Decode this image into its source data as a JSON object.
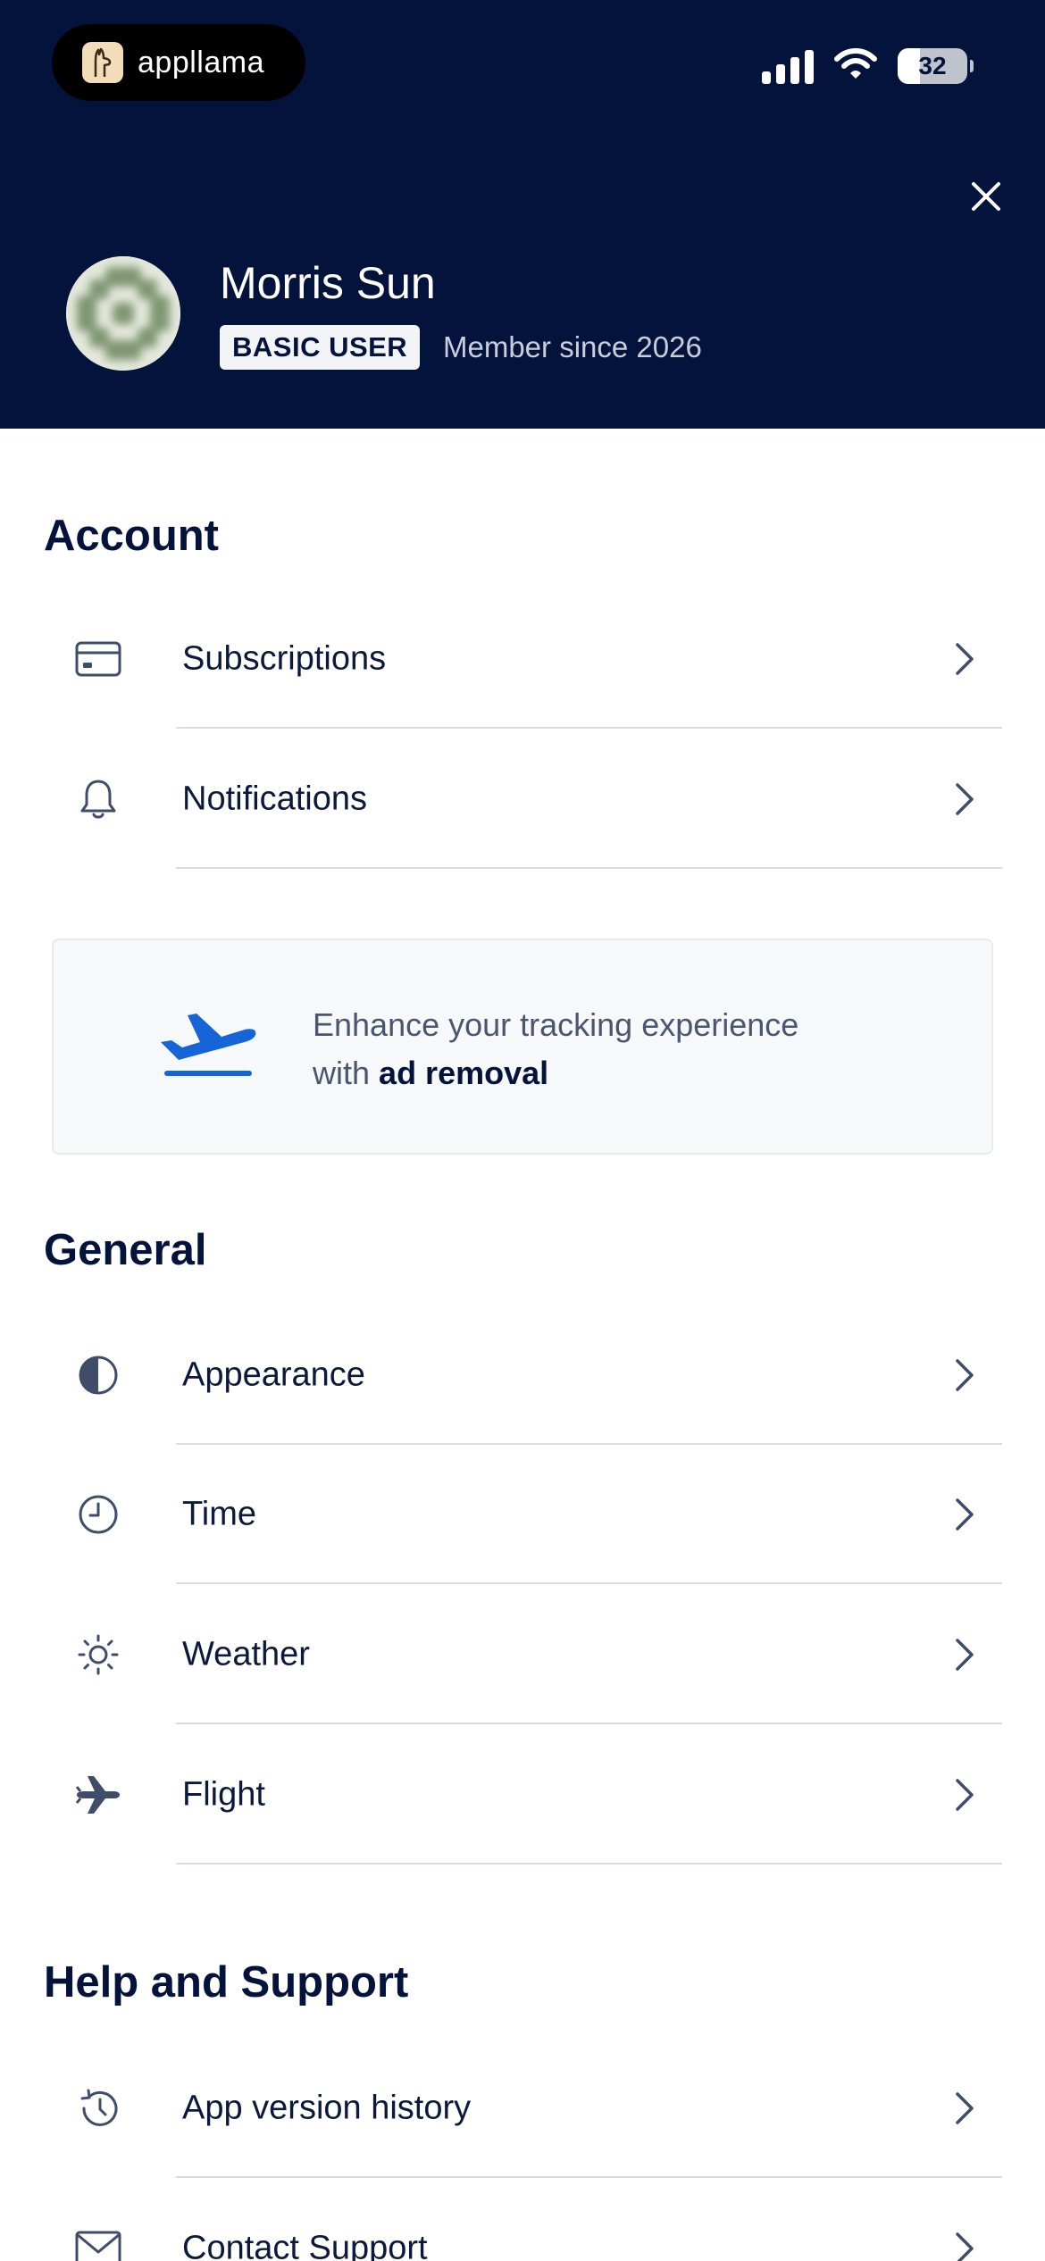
{
  "status_bar": {
    "app_name": "appllama",
    "battery_level": "32"
  },
  "profile": {
    "name": "Morris Sun",
    "badge": "BASIC USER",
    "member_since": "Member since 2026"
  },
  "sections": {
    "account": {
      "title": "Account",
      "items": [
        {
          "label": "Subscriptions",
          "icon": "credit-card-icon"
        },
        {
          "label": "Notifications",
          "icon": "bell-icon"
        }
      ]
    },
    "promo": {
      "text_line1": "Enhance your tracking experience",
      "text_prefix": "with",
      "text_bold": "ad removal"
    },
    "general": {
      "title": "General",
      "items": [
        {
          "label": "Appearance",
          "icon": "half-circle-icon"
        },
        {
          "label": "Time",
          "icon": "clock-icon"
        },
        {
          "label": "Weather",
          "icon": "sun-icon"
        },
        {
          "label": "Flight",
          "icon": "airplane-icon"
        }
      ]
    },
    "help": {
      "title": "Help and Support",
      "items": [
        {
          "label": "App version history",
          "icon": "history-icon"
        },
        {
          "label": "Contact Support",
          "icon": "mail-icon"
        }
      ]
    }
  },
  "colors": {
    "header_bg": "#03133c",
    "text_primary": "#0b1a3a",
    "accent_blue": "#1565d8",
    "divider": "#d9dce2"
  }
}
